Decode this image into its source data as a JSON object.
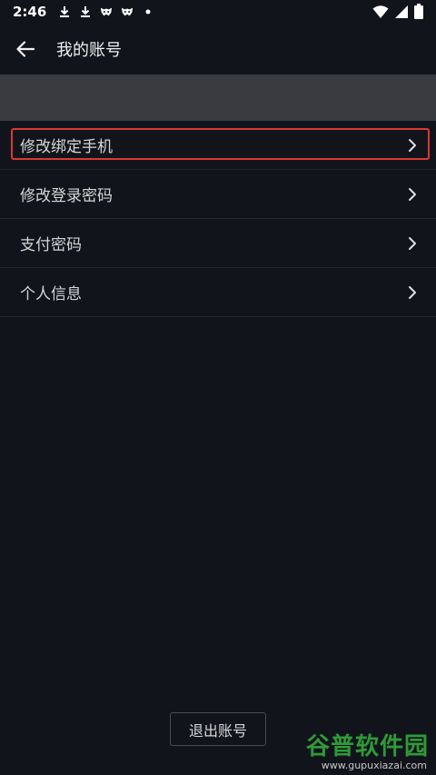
{
  "status_bar": {
    "time": "2:46",
    "left_icons": [
      "download-icon",
      "download-icon",
      "game-controller-icon",
      "game-controller-icon",
      "dot-icon"
    ],
    "right_icons": [
      "wifi-icon",
      "signal-icon",
      "battery-icon"
    ]
  },
  "header": {
    "title": "我的账号"
  },
  "menu": {
    "items": [
      {
        "label": "修改绑定手机",
        "highlighted": true
      },
      {
        "label": "修改登录密码"
      },
      {
        "label": "支付密码"
      },
      {
        "label": "个人信息"
      }
    ]
  },
  "footer": {
    "logout_label": "退出账号"
  },
  "watermark": {
    "title": "谷普软件园",
    "url": "www.gupuxiazai.com"
  },
  "colors": {
    "background": "#12141c",
    "banner": "#3a3b41",
    "highlight": "#d83a34",
    "watermark": "#2f9a38"
  }
}
